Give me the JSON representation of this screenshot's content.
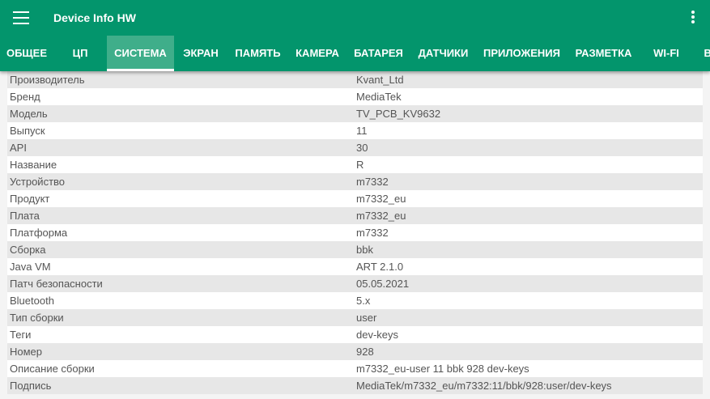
{
  "app": {
    "title": "Device Info HW"
  },
  "tabs": [
    "ОБЩЕЕ",
    "ЦП",
    "СИСТЕМА",
    "ЭКРАН",
    "ПАМЯТЬ",
    "КАМЕРА",
    "БАТАРЕЯ",
    "ДАТЧИКИ",
    "ПРИЛОЖЕНИЯ",
    "РАЗМЕТКА",
    "WI-FI",
    "ВІ"
  ],
  "active_tab": "СИСТЕМА",
  "rows": [
    [
      "Производитель",
      "Kvant_Ltd"
    ],
    [
      "Бренд",
      "MediaTek"
    ],
    [
      "Модель",
      "TV_PCB_KV9632"
    ],
    [
      "Выпуск",
      "11"
    ],
    [
      "API",
      "30"
    ],
    [
      "Название",
      "R"
    ],
    [
      "Устройство",
      "m7332"
    ],
    [
      "Продукт",
      "m7332_eu"
    ],
    [
      "Плата",
      "m7332_eu"
    ],
    [
      "Платформа",
      "m7332"
    ],
    [
      "Сборка",
      "bbk"
    ],
    [
      "Java VM",
      "ART 2.1.0"
    ],
    [
      "Патч безопасности",
      "05.05.2021"
    ],
    [
      "Bluetooth",
      "5.x"
    ],
    [
      "Тип сборки",
      "user"
    ],
    [
      "Теги",
      "dev-keys"
    ],
    [
      "Номер",
      "928"
    ],
    [
      "Описание сборки",
      "m7332_eu-user 11 bbk 928 dev-keys"
    ],
    [
      "Подпись",
      "MediaTek/m7332_eu/m7332:11/bbk/928:user/dev-keys"
    ]
  ]
}
